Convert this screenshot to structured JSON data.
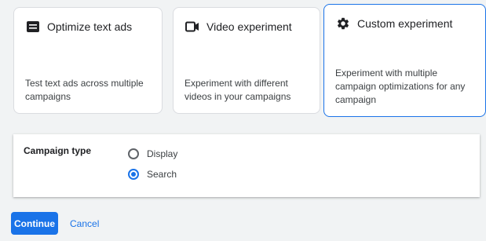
{
  "cards": [
    {
      "icon": "text-ad-icon",
      "title": "Optimize text ads",
      "description": "Test text ads across multiple campaigns",
      "selected": false
    },
    {
      "icon": "video-camera-icon",
      "title": "Video experiment",
      "description": "Experiment with different videos in your campaigns",
      "selected": false
    },
    {
      "icon": "gear-icon",
      "title": "Custom experiment",
      "description": "Experiment with multiple campaign optimizations for any campaign",
      "selected": true
    }
  ],
  "campaign_type": {
    "label": "Campaign type",
    "options": [
      {
        "label": "Display",
        "checked": false
      },
      {
        "label": "Search",
        "checked": true
      }
    ]
  },
  "actions": {
    "continue_label": "Continue",
    "cancel_label": "Cancel"
  },
  "colors": {
    "accent": "#1a73e8",
    "background": "#f1f3f4",
    "border": "#dadce0"
  }
}
